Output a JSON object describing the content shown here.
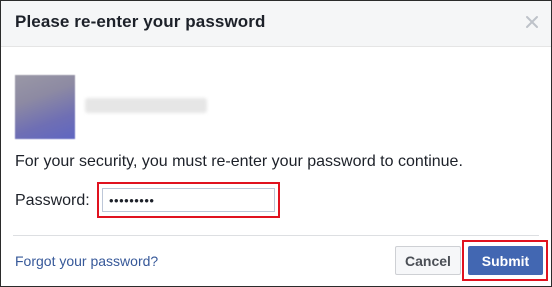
{
  "dialog": {
    "title": "Please re-enter your password",
    "close_icon": "close-icon"
  },
  "account": {
    "avatar": "blurred-profile-photo",
    "name": ""
  },
  "message": "For your security, you must re-enter your password to continue.",
  "password": {
    "label": "Password:",
    "value": "•••••••••"
  },
  "footer": {
    "forgot_link": "Forgot your password?",
    "cancel_label": "Cancel",
    "submit_label": "Submit"
  },
  "colors": {
    "header_bg": "#f5f6f7",
    "link": "#365899",
    "primary_button": "#4267b2",
    "highlight": "#e0121f"
  }
}
